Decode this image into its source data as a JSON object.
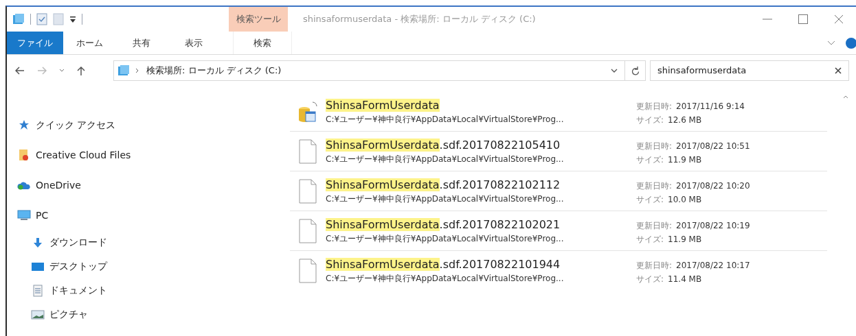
{
  "window": {
    "title": "shinsaformuserdata - 検索場所: ローカル ディスク (C:)"
  },
  "context_tab": {
    "label": "検索ツール"
  },
  "ribbon_tabs": [
    {
      "label": "ファイル",
      "kind": "file",
      "selected": false
    },
    {
      "label": "ホーム",
      "kind": "tab",
      "selected": false
    },
    {
      "label": "共有",
      "kind": "tab",
      "selected": false
    },
    {
      "label": "表示",
      "kind": "tab",
      "selected": false
    },
    {
      "label": "検索",
      "kind": "context",
      "selected": false
    }
  ],
  "address_bar": {
    "path": "検索場所: ローカル ディスク (C:)"
  },
  "search": {
    "value": "shinsaformuserdata"
  },
  "sidebar": {
    "items": [
      {
        "label": "クイック アクセス",
        "kind": "star"
      },
      {
        "label": "Creative Cloud Files",
        "kind": "cloudfiles"
      },
      {
        "label": "OneDrive",
        "kind": "onedrive"
      },
      {
        "label": "PC",
        "kind": "pc",
        "children": [
          {
            "label": "ダウンロード",
            "kind": "download"
          },
          {
            "label": "デスクトップ",
            "kind": "desktop"
          },
          {
            "label": "ドキュメント",
            "kind": "document"
          },
          {
            "label": "ピクチャ",
            "kind": "picture"
          }
        ]
      }
    ]
  },
  "files": [
    {
      "kind": "database",
      "name_match": "ShinsaFormUserdata",
      "path": "C:¥ユーザー¥神中良行¥AppData¥Local¥VirtualStore¥Prog...",
      "modified_label": "更新日時:",
      "modified": "2017/11/16 9:14",
      "size_label": "サイズ:",
      "size": "12.6 MB"
    },
    {
      "kind": "file",
      "name_match": "ShinsaFormUserdata",
      "name_rest": ".sdf.20170822105410",
      "path": "C:¥ユーザー¥神中良行¥AppData¥Local¥VirtualStore¥Prog...",
      "modified_label": "更新日時:",
      "modified": "2017/08/22 10:51",
      "size_label": "サイズ:",
      "size": "11.9 MB"
    },
    {
      "kind": "file",
      "name_match": "ShinsaFormUserdata",
      "name_rest": ".sdf.20170822102112",
      "path": "C:¥ユーザー¥神中良行¥AppData¥Local¥VirtualStore¥Prog...",
      "modified_label": "更新日時:",
      "modified": "2017/08/22 10:20",
      "size_label": "サイズ:",
      "size": "10.0 MB"
    },
    {
      "kind": "file",
      "name_match": "ShinsaFormUserdata",
      "name_rest": ".sdf.20170822102021",
      "path": "C:¥ユーザー¥神中良行¥AppData¥Local¥VirtualStore¥Prog...",
      "modified_label": "更新日時:",
      "modified": "2017/08/22 10:19",
      "size_label": "サイズ:",
      "size": "11.9 MB"
    },
    {
      "kind": "file",
      "name_match": "ShinsaFormUserdata",
      "name_rest": ".sdf.20170822101944",
      "path": "C:¥ユーザー¥神中良行¥AppData¥Local¥VirtualStore¥Prog...",
      "modified_label": "更新日時:",
      "modified": "2017/08/22 10:17",
      "size_label": "サイズ:",
      "size": "11.4 MB"
    }
  ]
}
